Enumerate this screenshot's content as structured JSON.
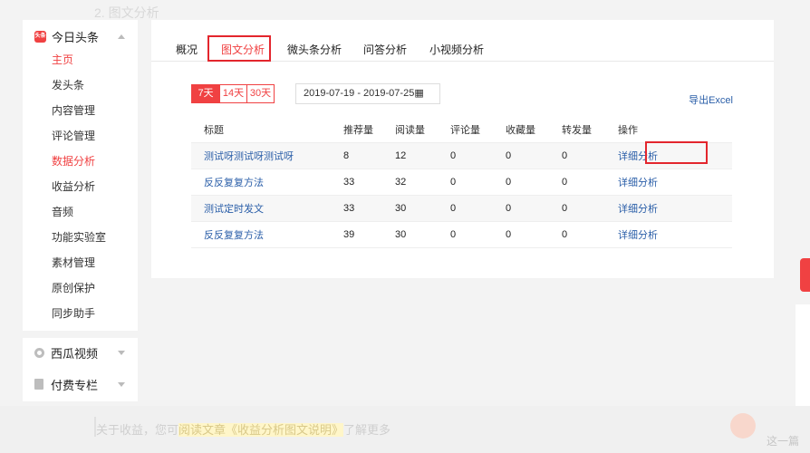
{
  "page": {
    "top_title": "2. 图文分析"
  },
  "sidebar": {
    "app": {
      "badge": "头条",
      "label": "今日头条"
    },
    "items": [
      {
        "label": "主页",
        "active": true
      },
      {
        "label": "发头条",
        "active": false
      },
      {
        "label": "内容管理",
        "active": false
      },
      {
        "label": "评论管理",
        "active": false
      },
      {
        "label": "数据分析",
        "active": true
      },
      {
        "label": "收益分析",
        "active": false
      },
      {
        "label": "音频",
        "active": false
      },
      {
        "label": "功能实验室",
        "active": false
      },
      {
        "label": "素材管理",
        "active": false
      },
      {
        "label": "原创保护",
        "active": false
      },
      {
        "label": "同步助手",
        "active": false
      }
    ],
    "sections": [
      {
        "label": "西瓜视频",
        "icon": "video-icon"
      },
      {
        "label": "付费专栏",
        "icon": "doc-icon"
      }
    ]
  },
  "tabs": [
    {
      "label": "概况"
    },
    {
      "label": "图文分析"
    },
    {
      "label": "微头条分析"
    },
    {
      "label": "问答分析"
    },
    {
      "label": "小视频分析"
    }
  ],
  "range": {
    "options": [
      "7天",
      "14天",
      "30天"
    ],
    "selected": "7天",
    "date_range": "2019-07-19  -  2019-07-25"
  },
  "export_label": "导出Excel",
  "table": {
    "columns": [
      "标题",
      "推荐量",
      "阅读量",
      "评论量",
      "收藏量",
      "转发量",
      "操作"
    ],
    "rows": [
      {
        "title": "测试呀测试呀测试呀",
        "rec": "8",
        "read": "12",
        "comment": "0",
        "fav": "0",
        "share": "0",
        "action": "详细分析"
      },
      {
        "title": "反反复复方法",
        "rec": "33",
        "read": "32",
        "comment": "0",
        "fav": "0",
        "share": "0",
        "action": "详细分析"
      },
      {
        "title": "测试定时发文",
        "rec": "33",
        "read": "30",
        "comment": "0",
        "fav": "0",
        "share": "0",
        "action": "详细分析"
      },
      {
        "title": "反反复复方法",
        "rec": "39",
        "read": "30",
        "comment": "0",
        "fav": "0",
        "share": "0",
        "action": "详细分析"
      }
    ]
  },
  "notice": {
    "prefix": "关于收益，您可",
    "highlight": "阅读文章《收益分析图文说明》",
    "suffix": "了解更多",
    "right": "这一篇"
  },
  "colors": {
    "accent": "#f04142",
    "link": "#2a5ea8",
    "annotation": "#e3262d"
  }
}
